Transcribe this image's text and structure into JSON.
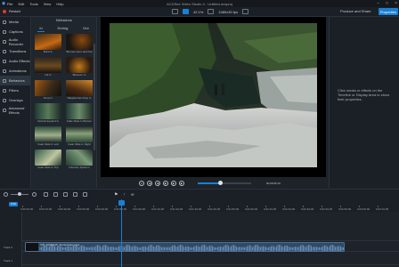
{
  "menu": {
    "items": [
      "File",
      "Edit",
      "Tools",
      "View",
      "Help"
    ],
    "title": "ACDSee Video Studio 4 - Untitled.avsproj"
  },
  "toolbar": {
    "restart_label": "Restart",
    "zoom_value": "42.1%",
    "resolution_value": "1080x30 fps",
    "produce_label": "Produce and Share",
    "properties_label": "Properties"
  },
  "sidebar": {
    "items": [
      {
        "label": "Media",
        "icon": "film-icon"
      },
      {
        "label": "Captions",
        "icon": "caption-icon"
      },
      {
        "label": "Audio Recorder",
        "icon": "microphone-icon"
      },
      {
        "label": "Transitions",
        "icon": "transition-icon"
      },
      {
        "label": "Audio Effects",
        "icon": "audio-effects-icon"
      },
      {
        "label": "Animations",
        "icon": "animation-icon"
      },
      {
        "label": "Behaviors",
        "icon": "behavior-icon"
      },
      {
        "label": "Filters",
        "icon": "filter-icon"
      },
      {
        "label": "Overlays",
        "icon": "overlay-icon"
      },
      {
        "label": "Advanced Effects",
        "icon": "advanced-effects-icon"
      }
    ]
  },
  "panel": {
    "title": "Behaviors",
    "tabs": [
      "In",
      "During",
      "Out"
    ],
    "items": [
      {
        "label": "Burst In",
        "style": "t1"
      },
      {
        "label": "Bounce Here and Out",
        "style": "t2"
      },
      {
        "label": "Lift In",
        "style": "t3"
      },
      {
        "label": "Blossom In",
        "style": "t4"
      },
      {
        "label": "Drop In",
        "style": "t5"
      },
      {
        "label": "Raspberries Drop In",
        "style": "t6"
      },
      {
        "label": "Vertical Expand In",
        "style": "t7"
      },
      {
        "label": "Fade Slide In Bottom",
        "style": "t8"
      },
      {
        "label": "Fade Slide In Left",
        "style": "t9"
      },
      {
        "label": "Fade Slide In Right",
        "style": "t10"
      },
      {
        "label": "Fade Slide In Top",
        "style": "t11"
      },
      {
        "label": "Filmstrip Spiral In",
        "style": "t12"
      }
    ]
  },
  "player": {
    "timecode": "00:00:05;10",
    "progress": 0.42
  },
  "properties": {
    "message": "Click media or effects on the Timeline or Display Area to show their properties."
  },
  "timeline": {
    "tick_labels": [
      "0:00:00;00",
      "0:00:10;00",
      "0:00:20;00",
      "0:00:30;00",
      "0:00:40;00",
      "0:00:50;00",
      "0:01:00;00",
      "0:01:10;00",
      "0:01:20;00",
      "0:01:30;00",
      "0:01:40;00",
      "0:01:50;00",
      "0:02:00;00",
      "0:02:10;00",
      "0:02:20;00",
      "0:02:30;00",
      "0:02:40;00",
      "0:02:50;00",
      "0:03:00;00",
      "0:03:10;00"
    ],
    "track_head": "0:00",
    "playhead_label": "0:00:32;29",
    "tracks": [
      "Track 3",
      "Track 2",
      "Track 1"
    ],
    "clip_name": "VID_20230115_SunsetLake.mp4"
  }
}
